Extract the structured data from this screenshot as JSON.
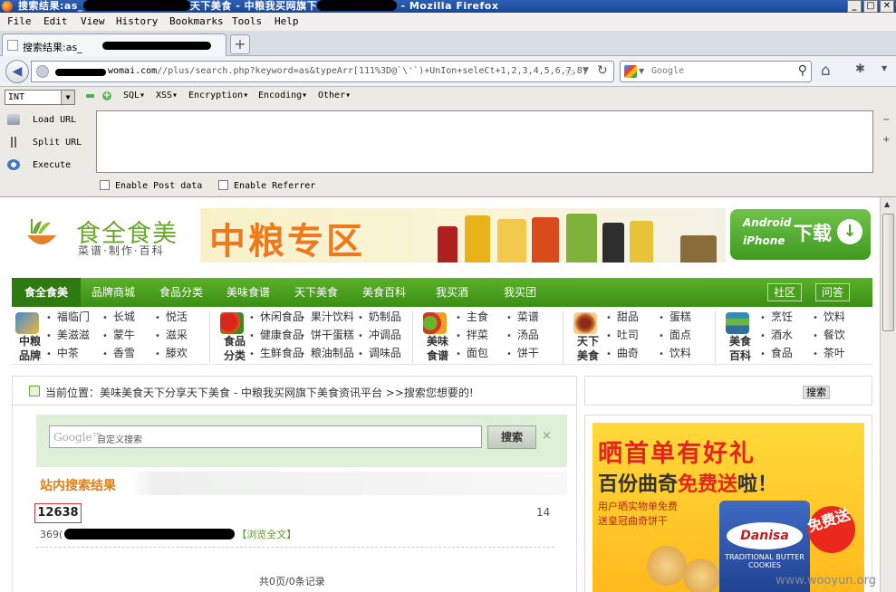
{
  "window": {
    "title_prefix": "搜索结果:as_",
    "title_suffix": "天下美食 - 中粮我买网旗下",
    "browser_name": "Mozilla Firefox",
    "buttons": [
      "_",
      "□",
      "✕"
    ]
  },
  "menubar": [
    "File",
    "Edit",
    "View",
    "History",
    "Bookmarks",
    "Tools",
    "Help"
  ],
  "tab": {
    "title": "搜索结果:as_"
  },
  "address": {
    "host": "womai.com",
    "path": "//plus/search.php?keyword=as&typeArr[111%3D@`\\'`)+UnIon+seleCt+1,2,3,4,5,6,7,8,"
  },
  "search": {
    "placeholder": "Google"
  },
  "hackbar": {
    "select_value": "INT",
    "menus": [
      "SQL▾",
      "XSS▾",
      "Encryption▾",
      "Encoding▾",
      "Other▾"
    ],
    "actions": {
      "load": "Load URL",
      "split": "Split URL",
      "execute": "Execute"
    },
    "enable_post": "Enable Post data",
    "enable_referrer": "Enable Referrer",
    "textarea_value": ""
  },
  "site": {
    "logo_name": "食全食美",
    "logo_sub": "菜谱·制作·百科",
    "banner_text": "中粮专区",
    "app_btn": {
      "os1": "Android",
      "os2": "iPhone",
      "label": "下载",
      "icon": "arrow-down-icon"
    },
    "nav": [
      "食全食美",
      "品牌商城",
      "食品分类",
      "美味食谱",
      "天下美食",
      "美食百科",
      "我买酒",
      "我买团"
    ],
    "nav_pills": [
      "社区",
      "问答"
    ],
    "categories": [
      {
        "label": "中粮品牌",
        "links": [
          "福临门",
          "长城",
          "悦活",
          "美滋滋",
          "蒙牛",
          "滋采",
          "中茶",
          "香雪",
          "滕欢"
        ]
      },
      {
        "label": "食品分类",
        "links": [
          "休闲食品",
          "果汁饮料",
          "奶制品",
          "健康食品",
          "饼干蛋糕",
          "冲调品",
          "生鲜食品",
          "粮油制品",
          "调味品"
        ]
      },
      {
        "label": "美味食谱",
        "links": [
          "主食",
          "菜谱",
          "拌菜",
          "汤品",
          "面包",
          "饼干"
        ]
      },
      {
        "label": "天下美食",
        "links": [
          "甜品",
          "蛋糕",
          "吐司",
          "面点",
          "曲奇",
          "饮料"
        ]
      },
      {
        "label": "美食百科",
        "links": [
          "烹饪",
          "饮料",
          "酒水",
          "餐饮",
          "食品",
          "茶叶"
        ]
      }
    ],
    "breadcrumb": "当前位置：美味美食天下分享天下美食 - 中粮我买网旗下美食资讯平台 >>搜索您想要的!",
    "right_search_btn": "搜索",
    "gsearch": {
      "logo": "Google™",
      "placeholder": "自定义搜索",
      "button": "搜索",
      "clear": "×"
    },
    "section_title": "站内搜索结果",
    "result": {
      "number": "12638",
      "count": "14",
      "prefix": "369(",
      "more": "【浏览全文】"
    },
    "pager": "共0页/0条记录",
    "ad": {
      "headline": "晒首单有好礼",
      "sub_prefix": "百份曲奇",
      "sub_highlight": "免费送",
      "sub_suffix": "啦！",
      "line1": "用户晒实物单免费",
      "line2": "送皇冠曲奇饼干",
      "brand": "Danisa",
      "box_text": "TRADITIONAL BUTTER COOKIES",
      "badge": "免费送"
    }
  },
  "watermark": "www.wooyun.org"
}
